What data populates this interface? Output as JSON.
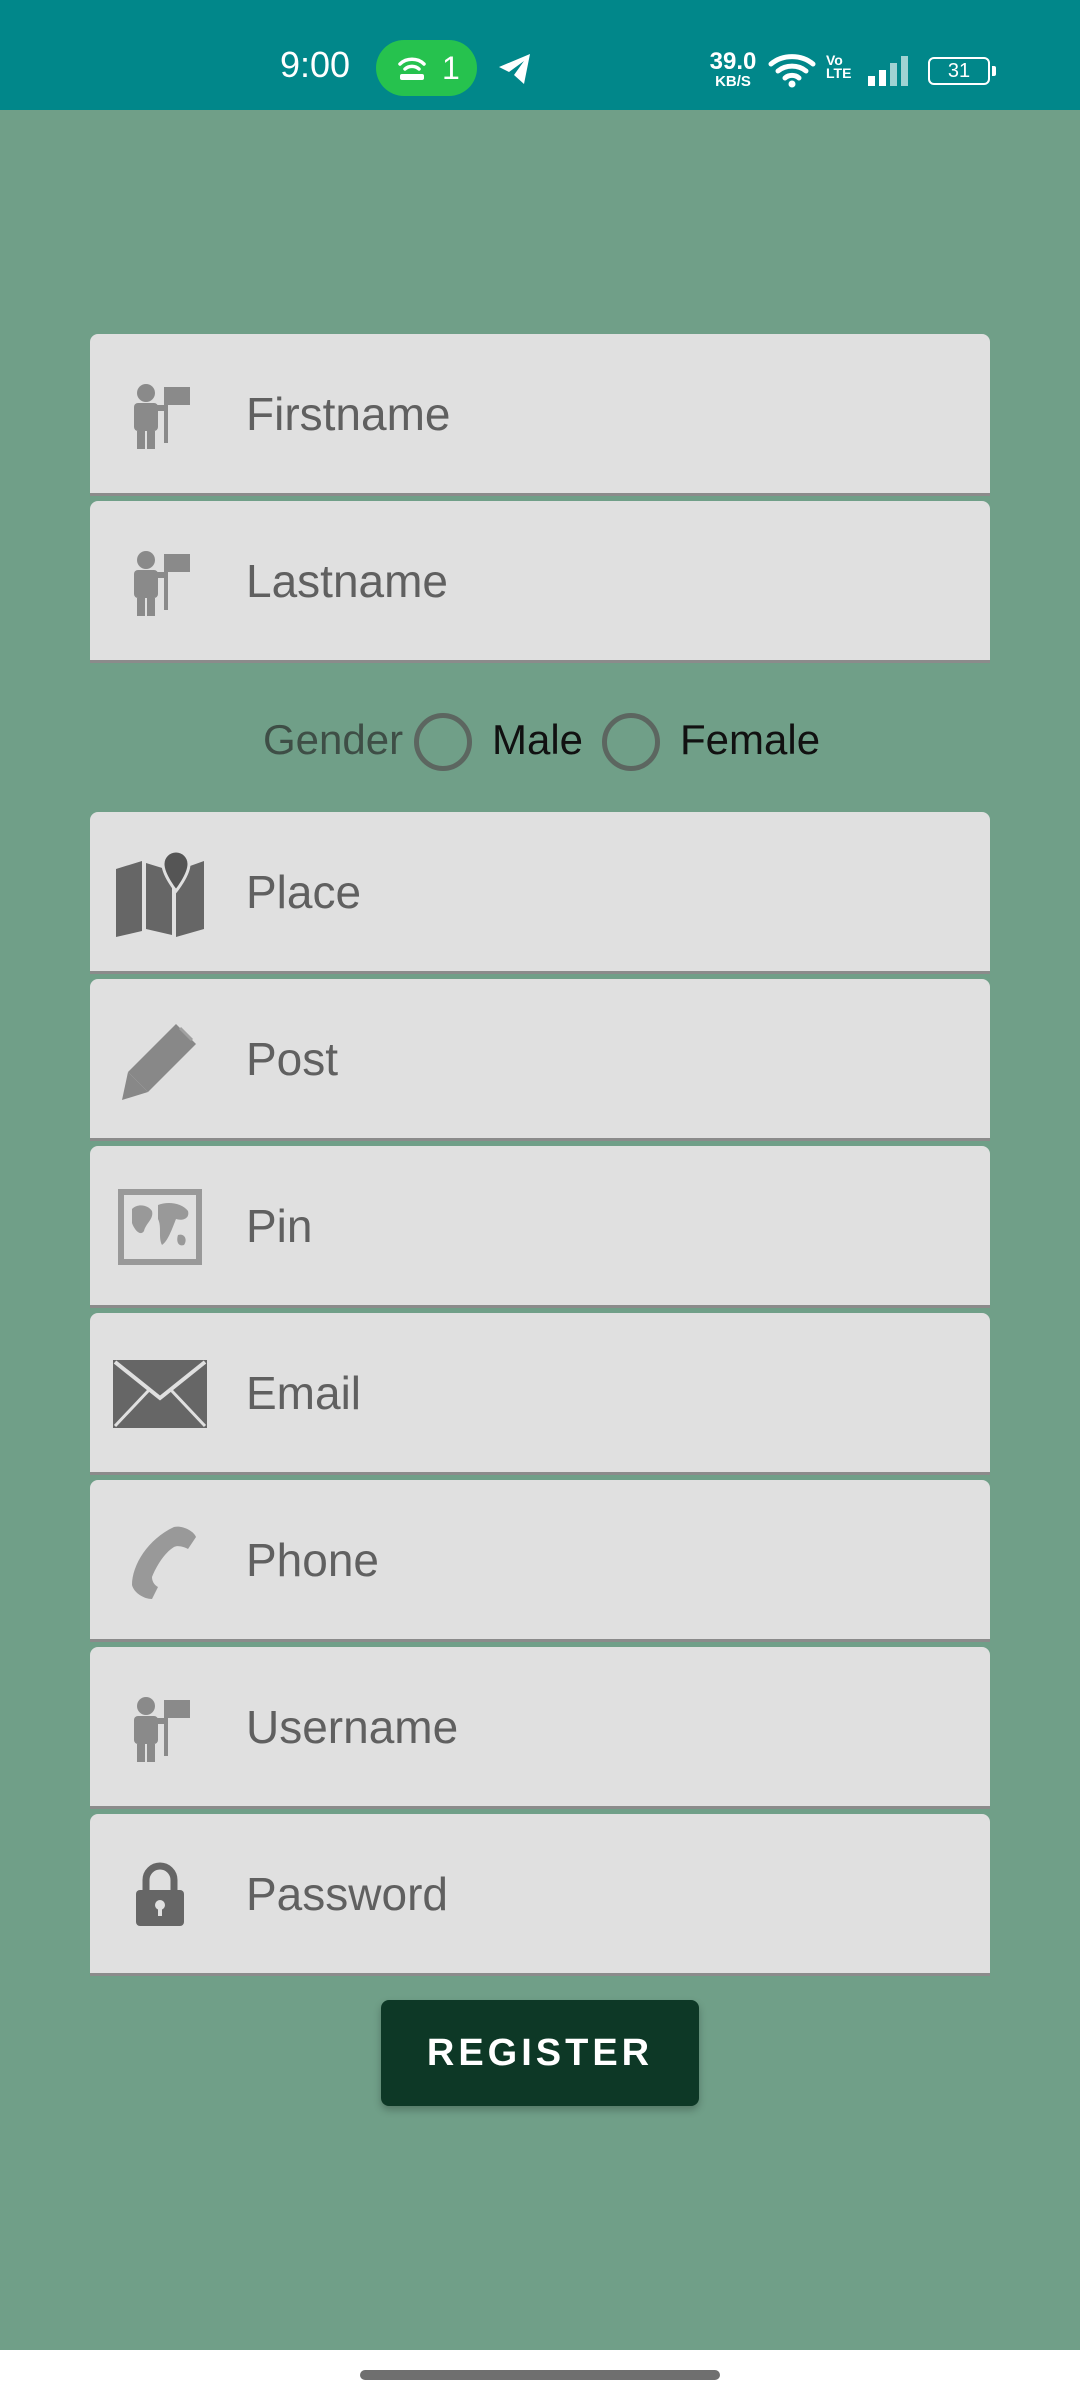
{
  "status_bar": {
    "time": "9:00",
    "hotspot_count": "1",
    "net_speed_value": "39.0",
    "net_speed_unit": "KB/S",
    "volte_line1": "Vo",
    "volte_line2": "LTE",
    "battery_level": "31",
    "icons": [
      "hotspot-icon",
      "telegram-icon",
      "wifi-icon",
      "signal-icon",
      "battery-icon"
    ]
  },
  "form": {
    "firstname": {
      "placeholder": "Firstname",
      "value": "",
      "icon": "user-flag-icon"
    },
    "lastname": {
      "placeholder": "Lastname",
      "value": "",
      "icon": "user-flag-icon"
    },
    "gender": {
      "label": "Gender",
      "options": [
        "Male",
        "Female"
      ],
      "selected": null
    },
    "place": {
      "placeholder": "Place",
      "value": "",
      "icon": "map-pin-icon"
    },
    "post": {
      "placeholder": "Post",
      "value": "",
      "icon": "pencil-icon"
    },
    "pin": {
      "placeholder": "Pin",
      "value": "",
      "icon": "world-map-icon"
    },
    "email": {
      "placeholder": "Email",
      "value": "",
      "icon": "envelope-icon"
    },
    "phone": {
      "placeholder": "Phone",
      "value": "",
      "icon": "phone-icon"
    },
    "username": {
      "placeholder": "Username",
      "value": "",
      "icon": "user-flag-icon"
    },
    "password": {
      "placeholder": "Password",
      "value": "",
      "icon": "lock-icon"
    }
  },
  "register_button": {
    "label": "REGISTER"
  },
  "colors": {
    "status_bar": "#01878a",
    "background": "#709f88",
    "field_background": "#e0e0e0",
    "button": "#0d3826",
    "hotspot_pill": "#26c24e"
  }
}
